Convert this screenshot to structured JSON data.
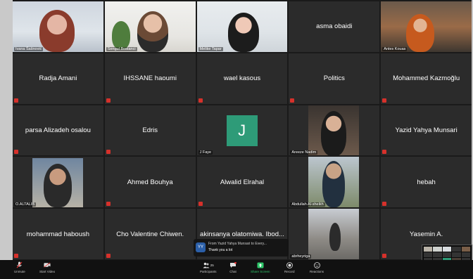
{
  "participants": [
    {
      "label": "Ivana Šašnović",
      "type": "video"
    },
    {
      "label": "Sengul Bostanci",
      "type": "video"
    },
    {
      "label": "Melike Tapar",
      "type": "video",
      "active": true
    },
    {
      "name": "asma obaidi",
      "type": "name"
    },
    {
      "label": "Antes Kouas",
      "type": "video"
    },
    {
      "name": "Radja Amani",
      "type": "name"
    },
    {
      "name": "IHSSANE haoumi",
      "type": "name"
    },
    {
      "name": "wael kasous",
      "type": "name"
    },
    {
      "name": "Politics",
      "type": "name"
    },
    {
      "name": "Mohammed Kazmoğlu",
      "type": "name"
    },
    {
      "name": "parsa Alizadeh osalou",
      "type": "name"
    },
    {
      "name": "Edris",
      "type": "name"
    },
    {
      "label": "J Faye",
      "type": "avatar",
      "initial": "J"
    },
    {
      "label": "Areeze Nadim",
      "type": "photo"
    },
    {
      "name": "Yazid Yahya Munsari",
      "type": "name"
    },
    {
      "label": "O.ALTALIB",
      "type": "photo"
    },
    {
      "name": "Ahmed Bouhya",
      "type": "name"
    },
    {
      "name": "Alwalid Elrahal",
      "type": "name"
    },
    {
      "label": "Abdullah Al-sheikh",
      "type": "photo"
    },
    {
      "name": "hebah",
      "type": "name"
    },
    {
      "name": "mohammad haboush",
      "type": "name"
    },
    {
      "name": "Cho Valentine Chiwen.",
      "type": "name"
    },
    {
      "name": "akinsanya olatomiwa. Ibod...",
      "type": "name"
    },
    {
      "label": "abrheyriga",
      "type": "photo"
    },
    {
      "name": "Yasemin A.",
      "type": "name"
    }
  ],
  "chat_notification": {
    "initials": "YY",
    "from": "From Yazid Yahya Munsari to Every...",
    "message": "Thank you a lot"
  },
  "toolbar": {
    "unmute": "Unmute",
    "start_video": "Start Video",
    "participants": "Participants",
    "participants_count": "25",
    "chat": "Chat",
    "share_screen": "Share Screen",
    "record": "Record",
    "reactions": "Reactions"
  },
  "colors": {
    "avatar_j": "#2e9b78",
    "active_border": "#c6d34a",
    "share_green": "#2fc66a",
    "muted_red": "#d6312b"
  }
}
